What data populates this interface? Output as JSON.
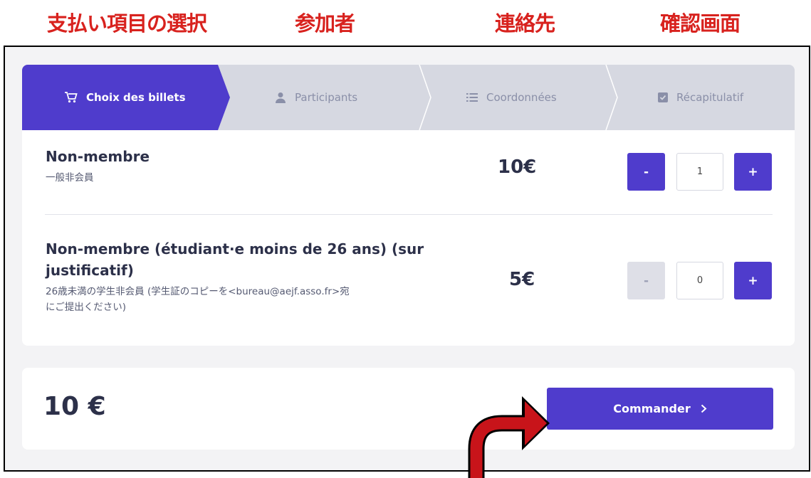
{
  "annotations": {
    "step1": "支払い項目の選択",
    "step2": "参加者",
    "step3": "連絡先",
    "step4": "確認画面",
    "annotation_color": "#d8221e"
  },
  "steps": [
    {
      "label": "Choix des billets",
      "icon": "cart-icon",
      "active": true
    },
    {
      "label": "Participants",
      "icon": "user-icon",
      "active": false
    },
    {
      "label": "Coordonnées",
      "icon": "list-icon",
      "active": false
    },
    {
      "label": "Récapitulatif",
      "icon": "check-square-icon",
      "active": false
    }
  ],
  "tickets": [
    {
      "name": "Non-membre",
      "description": "一般非会員",
      "price": "10€",
      "quantity": "1",
      "minus_label": "-",
      "plus_label": "+",
      "minus_enabled": true
    },
    {
      "name_line1": "Non-membre (étudiant·e moins de 26 ans) (sur",
      "name_line2": "justificatif)",
      "description_line1": "26歳未満の学生非会員 (学生証のコピーを<bureau@aejf.asso.fr>宛",
      "description_line2": "にご提出ください)",
      "price": "5€",
      "quantity": "0",
      "minus_label": "-",
      "plus_label": "+",
      "minus_enabled": false
    }
  ],
  "total": {
    "amount": "10 €",
    "order_label": "Commander",
    "order_icon": "chevron-right-icon"
  },
  "colors": {
    "accent": "#4f3ccc",
    "steps_background": "#d6d8e1",
    "page_background": "#f3f3f5"
  }
}
